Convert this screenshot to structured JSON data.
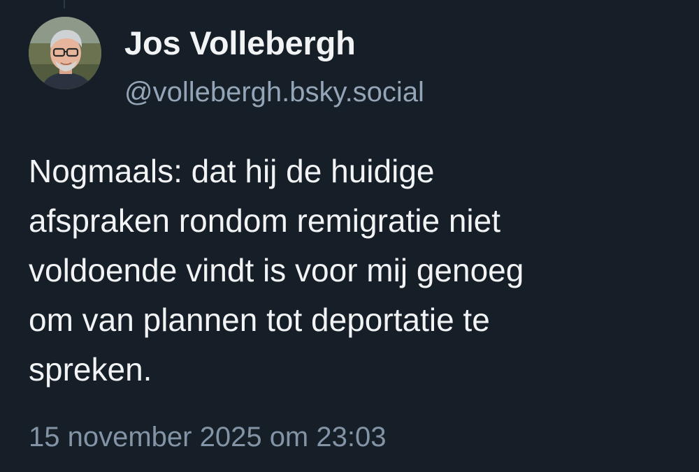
{
  "post": {
    "author_name": "Jos Vollebergh",
    "author_handle": "@vollebergh.bsky.social",
    "text": "Nogmaals: dat hij de huidige\nafspraken rondom remigratie niet\nvoldoende vindt is voor mij genoeg\nom van plannen tot deportatie te\nspreken.",
    "timestamp": "15 november 2025 om 23:03"
  },
  "colors": {
    "background": "#161e27",
    "primary_text": "#f1f3f5",
    "secondary_text": "#93a5b7"
  },
  "icons": {
    "avatar": "profile-photo-avatar"
  }
}
